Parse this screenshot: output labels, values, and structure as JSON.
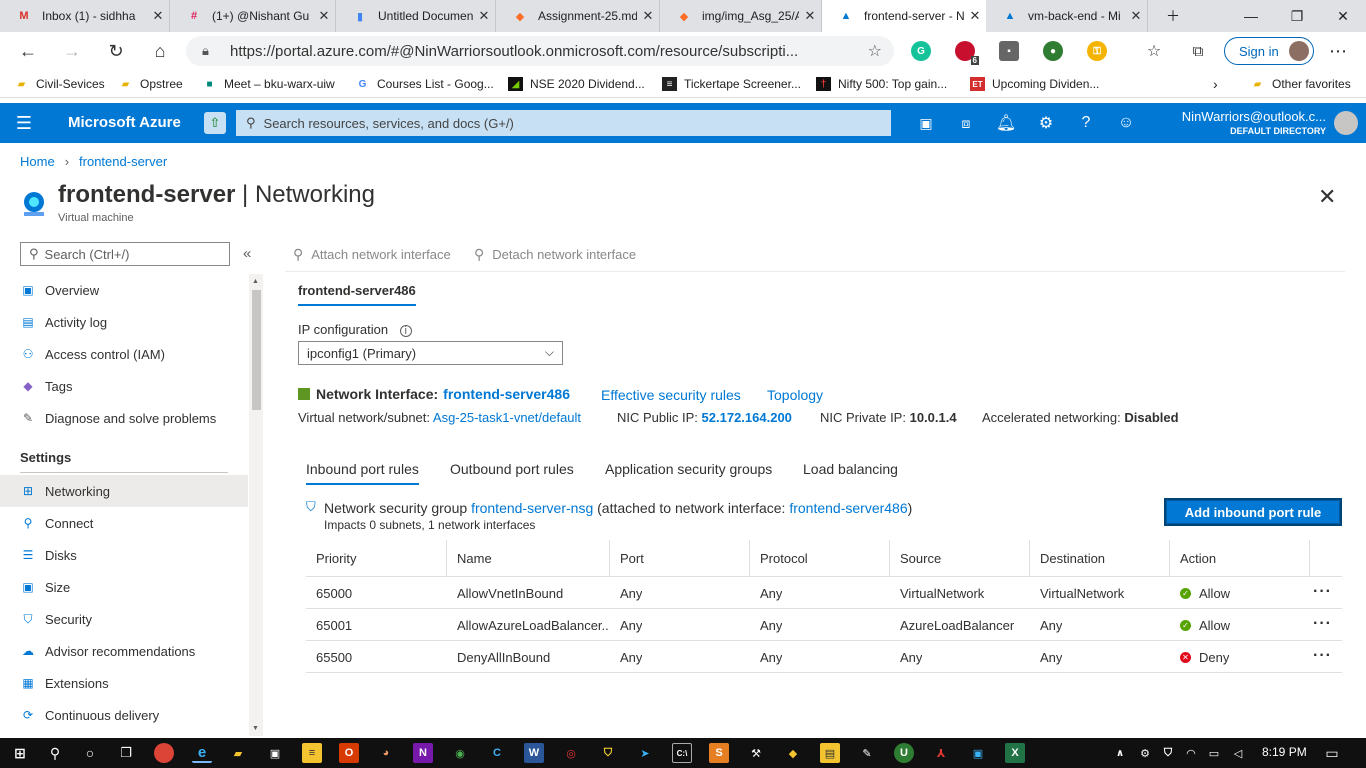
{
  "browser": {
    "tabs": [
      {
        "title": "Inbox (1) - sidhha",
        "icon": "gmail-icon"
      },
      {
        "title": "(1+) @Nishant Gu",
        "icon": "slack-icon"
      },
      {
        "title": "Untitled Documen",
        "icon": "docs-icon"
      },
      {
        "title": "Assignment-25.md",
        "icon": "gitlab-icon"
      },
      {
        "title": "img/img_Asg_25/A",
        "icon": "gitlab-icon"
      },
      {
        "title": "frontend-server - N",
        "icon": "azure-icon"
      },
      {
        "title": "vm-back-end - Mi",
        "icon": "azure-icon"
      }
    ],
    "active_tab": 5,
    "url": "https://portal.azure.com/#@NinWarriorsoutlook.onmicrosoft.com/resource/subscripti...",
    "signin_label": "Sign in",
    "ext_badge": "6",
    "favorites": [
      {
        "label": "Civil-Sevices",
        "icon": "folder-icon"
      },
      {
        "label": "Opstree",
        "icon": "folder-icon"
      },
      {
        "label": "Meet – bku-warx-uiw",
        "icon": "meet-icon"
      },
      {
        "label": "Courses List - Goog...",
        "icon": "google-icon"
      },
      {
        "label": "NSE 2020 Dividend...",
        "icon": "nse-icon"
      },
      {
        "label": "Tickertape Screener...",
        "icon": "tickertape-icon"
      },
      {
        "label": "Nifty 500: Top gain...",
        "icon": "nifty-icon"
      },
      {
        "label": "Upcoming Dividen...",
        "icon": "et-icon"
      }
    ],
    "other_favorites": "Other favorites"
  },
  "azure": {
    "brand": "Microsoft Azure",
    "search_placeholder": "Search resources, services, and docs (G+/)",
    "account_name": "NinWarriors@outlook.c...",
    "directory": "DEFAULT DIRECTORY"
  },
  "breadcrumb": {
    "home": "Home",
    "current": "frontend-server"
  },
  "page": {
    "title_resource": "frontend-server",
    "title_sep": " | ",
    "title_blade": "Networking",
    "subtitle": "Virtual machine"
  },
  "sidenav": {
    "search_placeholder": "Search (Ctrl+/)",
    "items": [
      {
        "label": "Overview",
        "icon": "monitor-icon",
        "color": "#0078d4"
      },
      {
        "label": "Activity log",
        "icon": "log-icon",
        "color": "#0078d4"
      },
      {
        "label": "Access control (IAM)",
        "icon": "people-icon",
        "color": "#0078d4"
      },
      {
        "label": "Tags",
        "icon": "tag-icon",
        "color": "#8661c5"
      },
      {
        "label": "Diagnose and solve problems",
        "icon": "wrench-icon",
        "color": "#605e5c"
      }
    ],
    "settings_header": "Settings",
    "settings_items": [
      {
        "label": "Networking",
        "icon": "network-icon",
        "color": "#0078d4"
      },
      {
        "label": "Connect",
        "icon": "connect-icon",
        "color": "#0078d4"
      },
      {
        "label": "Disks",
        "icon": "disk-icon",
        "color": "#0078d4"
      },
      {
        "label": "Size",
        "icon": "monitor-icon",
        "color": "#0078d4"
      },
      {
        "label": "Security",
        "icon": "shield-icon",
        "color": "#0078d4"
      },
      {
        "label": "Advisor recommendations",
        "icon": "advisor-icon",
        "color": "#0078d4"
      },
      {
        "label": "Extensions",
        "icon": "extensions-icon",
        "color": "#0078d4"
      },
      {
        "label": "Continuous delivery",
        "icon": "delivery-icon",
        "color": "#0078d4"
      }
    ],
    "selected": "Networking"
  },
  "commands": {
    "attach": "Attach network interface",
    "detach": "Detach network interface"
  },
  "nic": {
    "tab": "frontend-server486",
    "ip_config_label": "IP configuration",
    "ip_config_value": "ipconfig1 (Primary)",
    "interface_label": "Network Interface:",
    "interface_name": "frontend-server486",
    "effective_rules": "Effective security rules",
    "topology": "Topology",
    "vnet_label": "Virtual network/subnet:",
    "vnet_value": "Asg-25-task1-vnet/default",
    "public_ip_label": "NIC Public IP:",
    "public_ip": "52.172.164.200",
    "private_ip_label": "NIC Private IP:",
    "private_ip": "10.0.1.4",
    "accel_label": "Accelerated networking:",
    "accel_value": "Disabled"
  },
  "rule_tabs": [
    "Inbound port rules",
    "Outbound port rules",
    "Application security groups",
    "Load balancing"
  ],
  "nsg": {
    "prefix": "Network security group",
    "name": "frontend-server-nsg",
    "attached_text": "(attached to network interface:",
    "attached_nic": "frontend-server486",
    "close_paren": ")",
    "impacts": "Impacts 0 subnets, 1 network interfaces",
    "add_button": "Add inbound port rule"
  },
  "rules": {
    "columns": [
      "Priority",
      "Name",
      "Port",
      "Protocol",
      "Source",
      "Destination",
      "Action"
    ],
    "rows": [
      {
        "priority": "65000",
        "name": "AllowVnetInBound",
        "port": "Any",
        "protocol": "Any",
        "source": "VirtualNetwork",
        "destination": "VirtualNetwork",
        "action": "Allow",
        "status": "allow"
      },
      {
        "priority": "65001",
        "name": "AllowAzureLoadBalancer...",
        "port": "Any",
        "protocol": "Any",
        "source": "AzureLoadBalancer",
        "destination": "Any",
        "action": "Allow",
        "status": "allow"
      },
      {
        "priority": "65500",
        "name": "DenyAllInBound",
        "port": "Any",
        "protocol": "Any",
        "source": "Any",
        "destination": "Any",
        "action": "Deny",
        "status": "deny"
      }
    ]
  },
  "colors": {
    "azure_blue": "#0078d4",
    "allow_green": "#57a300",
    "deny_red": "#e00b1c"
  },
  "taskbar": {
    "time": "8:19 PM"
  }
}
